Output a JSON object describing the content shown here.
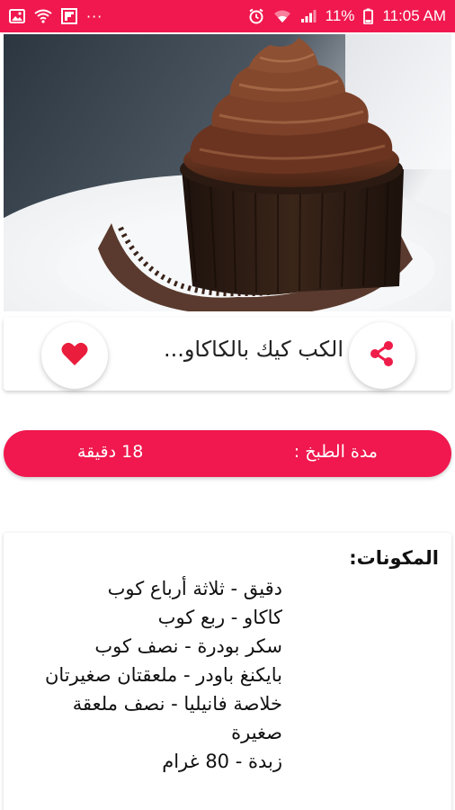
{
  "status_bar": {
    "background": "#f0184e",
    "left_icons": [
      "image-icon",
      "wifi-calling-icon",
      "flipboard-icon"
    ],
    "more_indicator": "···",
    "right_icons": [
      "alarm-icon",
      "wifi-icon",
      "signal-icon"
    ],
    "battery_text": "11%",
    "time": "11:05 AM"
  },
  "hero": {
    "image_alt": "chocolate cupcake with chocolate frosting"
  },
  "recipe": {
    "title": "الكب كيك بالكاكاو...",
    "share_icon": "share-icon",
    "favorite_icon": "heart-icon"
  },
  "cooking_time": {
    "label": "مدة الطبخ :",
    "value": "18 دقيقة"
  },
  "ingredients": {
    "heading": "المكونات:",
    "items": [
      "دقيق - ثلاثة أرباع كوب",
      "كاكاو - ربع كوب",
      "سكر بودرة - نصف كوب",
      "بايكنغ باودر - ملعقتان صغيرتان",
      "خلاصة فانيليا - نصف ملعقة صغيرة",
      "زبدة - 80 غرام"
    ]
  },
  "colors": {
    "accent": "#f0184e",
    "heart": "#ea1d3c",
    "share": "#ee1c49"
  }
}
